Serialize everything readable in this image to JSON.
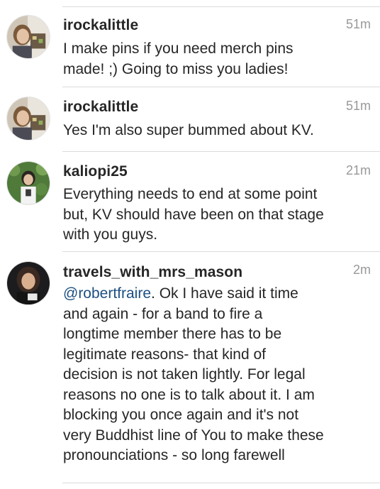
{
  "comments": [
    {
      "username": "irockalittle",
      "time": "51m",
      "lines": [
        "I make pins if you need merch pins",
        "made! ;) Going to miss you ladies!"
      ]
    },
    {
      "username": "irockalittle",
      "time": "51m",
      "lines": [
        "Yes I'm also super bummed about KV."
      ]
    },
    {
      "username": "kaliopi25",
      "time": "21m",
      "lines": [
        "Everything needs to end at some point",
        "but, KV should have been on that stage",
        "with you guys."
      ]
    },
    {
      "username": "travels_with_mrs_mason",
      "time": "2m",
      "mention": "@robertfraire",
      "first_line_rest": ". Ok I have said it time",
      "lines": [
        "and again - for a band to fire a",
        "longtime member there has to be",
        "legitimate reasons- that kind of",
        "decision is not taken lightly. For legal",
        "reasons no one is to talk about it.  I am",
        "blocking you once again and it's not",
        "very Buddhist line of You to make these",
        "pronounciations - so long farewell"
      ]
    }
  ],
  "colors": {
    "text": "#262626",
    "mention": "#1d4f82",
    "timestamp": "#999999",
    "divider": "#dbdbdb"
  }
}
